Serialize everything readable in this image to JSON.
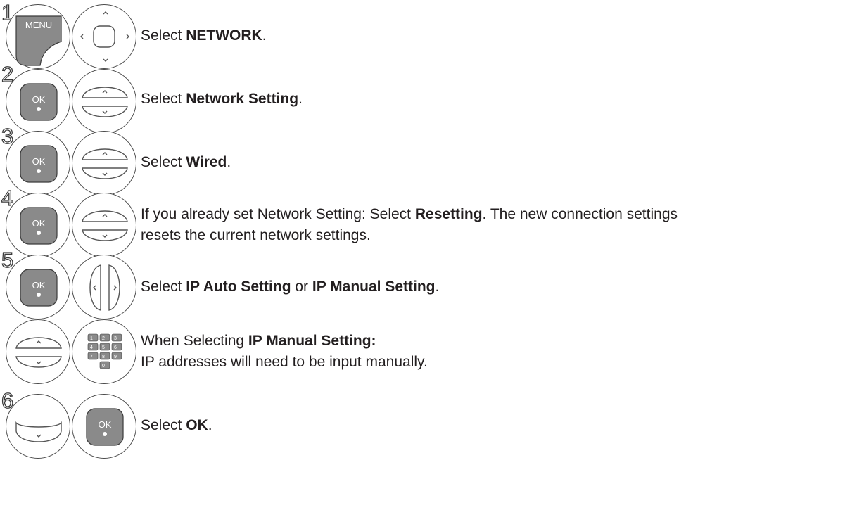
{
  "steps": [
    {
      "number": "1",
      "buttons": [
        "menu-key",
        "dpad"
      ],
      "text": [
        "Select ",
        "NETWORK",
        "."
      ]
    },
    {
      "number": "2",
      "buttons": [
        "ok-key",
        "up-down"
      ],
      "text": [
        "Select ",
        "Network Setting",
        "."
      ]
    },
    {
      "number": "3",
      "buttons": [
        "ok-key",
        "up-down"
      ],
      "text": [
        "Select ",
        "Wired",
        "."
      ]
    },
    {
      "number": "4",
      "buttons": [
        "ok-key",
        "up-down"
      ],
      "text": [
        "If you already set Network Setting: Select ",
        "Resetting",
        ". The new connection settings"
      ],
      "text_line2": "resets the current network settings."
    },
    {
      "number": "5",
      "buttons": [
        "ok-key",
        "left-right"
      ],
      "text": [
        "Select ",
        "IP Auto Setting",
        " or ",
        "IP Manual Setting",
        "."
      ]
    },
    {
      "number": "",
      "buttons": [
        "up-down",
        "number-keypad"
      ],
      "text": [
        "When Selecting ",
        "IP Manual Setting:"
      ],
      "text_line2": "IP addresses will need to be input manually."
    },
    {
      "number": "6",
      "buttons": [
        "down-key",
        "ok-key"
      ],
      "text": [
        "Select ",
        "OK",
        "."
      ]
    }
  ],
  "labels": {
    "menu": "MENU",
    "ok": "OK"
  },
  "keypad_keys": [
    "1",
    "2",
    "3",
    "4",
    "5",
    "6",
    "7",
    "8",
    "9",
    "0"
  ]
}
